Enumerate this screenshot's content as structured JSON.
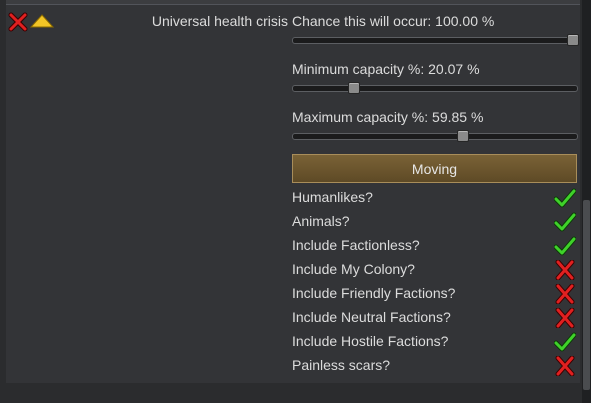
{
  "incident": {
    "title": "Universal health crisis",
    "delete_icon": "red-x-icon",
    "collapse_icon": "yellow-up-triangle-icon"
  },
  "chance": {
    "label": "Chance this will occur: 100.00 %",
    "value_fraction": 1.0
  },
  "min_capacity": {
    "label": "Minimum capacity %: 20.07 %",
    "value_fraction": 0.2007
  },
  "max_capacity": {
    "label": "Maximum capacity %: 59.85 %",
    "value_fraction": 0.5985
  },
  "mode_button": {
    "label": "Moving"
  },
  "options": [
    {
      "label": "Humanlikes?",
      "checked": true
    },
    {
      "label": "Animals?",
      "checked": true
    },
    {
      "label": "Include Factionless?",
      "checked": true
    },
    {
      "label": "Include My Colony?",
      "checked": false
    },
    {
      "label": "Include Friendly Factions?",
      "checked": false
    },
    {
      "label": "Include Neutral Factions?",
      "checked": false
    },
    {
      "label": "Include Hostile Factions?",
      "checked": true
    },
    {
      "label": "Painless scars?",
      "checked": false
    }
  ],
  "colors": {
    "check_green": "#3fd12a",
    "cross_red": "#e02020",
    "triangle_yellow": "#f2c526",
    "button_brown": "#6b5530"
  }
}
